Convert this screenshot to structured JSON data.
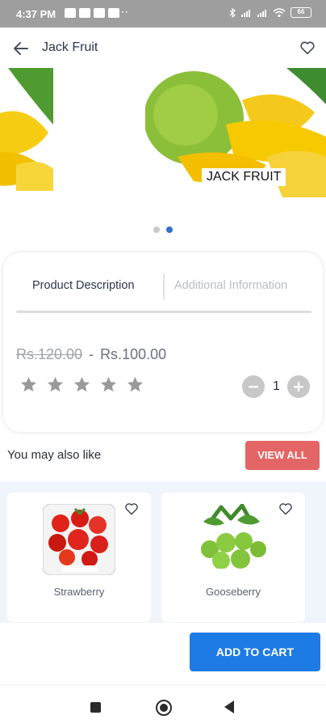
{
  "status_bar": {
    "time": "4:37 PM",
    "dots": "⋯",
    "battery": "66"
  },
  "header": {
    "title": "Jack Fruit",
    "back_icon": "arrow-left-icon",
    "favorite_icon": "heart-outline-icon"
  },
  "carousel": {
    "slide_label": "JACK FRUIT",
    "slide_count": 2,
    "active_index": 1
  },
  "product_details": {
    "tabs": [
      {
        "label": "Product Description",
        "active": true
      },
      {
        "label": "Additional Information",
        "active": false
      }
    ],
    "old_price": "Rs.120.00",
    "separator": "-",
    "price": "Rs.100.00",
    "rating": {
      "value": 0,
      "max": 5
    },
    "quantity": "1"
  },
  "also_like": {
    "title": "You may also like",
    "view_all_label": "VIEW ALL",
    "items": [
      {
        "name": "Strawberry"
      },
      {
        "name": "Gooseberry"
      }
    ]
  },
  "cart": {
    "add_label": "ADD TO CART"
  },
  "colors": {
    "accent_blue": "#1e7be6",
    "view_all_red": "#e46565",
    "star_gray": "#9a9a9a",
    "strip_background": "#f0f4fb"
  }
}
